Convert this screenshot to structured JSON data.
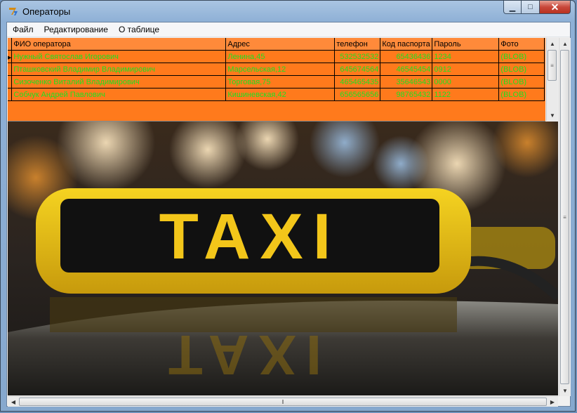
{
  "window": {
    "title": "Операторы"
  },
  "menu": [
    "Файл",
    "Редактирование",
    "О таблице"
  ],
  "grid": {
    "columns": [
      "ФИО оператора",
      "Адрес",
      "телефон",
      "Код паспорта",
      "Пароль",
      "Фото"
    ],
    "rows": [
      [
        "Нужный Святослав Игорович",
        "Ленина,45",
        "532532532",
        "65436436",
        "1234",
        "(BLOB)"
      ],
      [
        "Пташковский Владимир Владимирович",
        "Марсельская,12",
        "645674564",
        "46545454",
        "0912",
        "(BLOB)"
      ],
      [
        "Сизоченко Виталий Владимирович",
        "Торговая,75",
        "465465435",
        "35646543",
        "0000",
        "(BLOB)"
      ],
      [
        "Собчук Андрей Павлович",
        "Кишиневская,42",
        "656565656",
        "98765432",
        "1122",
        "(BLOB)"
      ]
    ]
  },
  "photo": {
    "sign_text": "TAXI"
  },
  "colors": {
    "grid_background": "#ff7a1c",
    "cell_text": "#20e020",
    "header_background": "#ff8a3a"
  },
  "icons": {
    "app": "app-icon",
    "minimize": "minimize-icon",
    "maximize": "maximize-icon",
    "close": "close-icon"
  }
}
